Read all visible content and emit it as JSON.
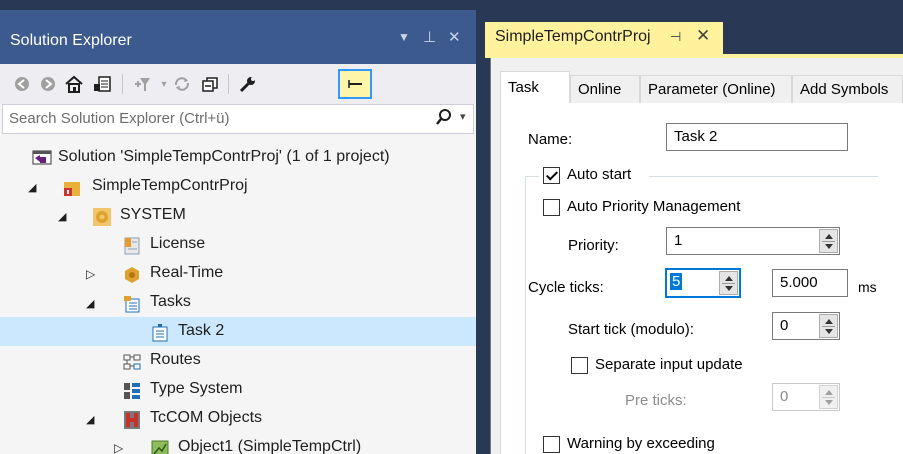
{
  "solution_explorer": {
    "title": "Solution Explorer",
    "search_placeholder": "Search Solution Explorer (Ctrl+ü)",
    "toolbar_icons": [
      "back-icon",
      "forward-icon",
      "home-icon",
      "switch-views-icon",
      "pending-changes-filter-icon",
      "sync-icon",
      "collapse-all-icon",
      "properties-wrench-icon",
      "preview-selected-icon"
    ],
    "tree": [
      {
        "label": "Solution 'SimpleTempContrProj' (1 of 1 project)",
        "icon": "solution-icon",
        "depth": 0,
        "arrow": ""
      },
      {
        "label": "SimpleTempContrProj",
        "icon": "twincat-project-icon",
        "depth": 1,
        "arrow": "expanded"
      },
      {
        "label": "SYSTEM",
        "icon": "system-gear-icon",
        "depth": 2,
        "arrow": "expanded"
      },
      {
        "label": "License",
        "icon": "license-icon",
        "depth": 3,
        "arrow": ""
      },
      {
        "label": "Real-Time",
        "icon": "realtime-icon",
        "depth": 3,
        "arrow": "collapsed"
      },
      {
        "label": "Tasks",
        "icon": "tasks-icon",
        "depth": 3,
        "arrow": "expanded"
      },
      {
        "label": "Task 2",
        "icon": "task-icon",
        "depth": 4,
        "arrow": "",
        "selected": true
      },
      {
        "label": "Routes",
        "icon": "routes-icon",
        "depth": 3,
        "arrow": ""
      },
      {
        "label": "Type System",
        "icon": "type-system-icon",
        "depth": 3,
        "arrow": ""
      },
      {
        "label": "TcCOM Objects",
        "icon": "tccom-objects-icon",
        "depth": 3,
        "arrow": "expanded"
      },
      {
        "label": "Object1 (SimpleTempCtrl)",
        "icon": "object-icon",
        "depth": 4,
        "arrow": "collapsed"
      }
    ]
  },
  "document": {
    "tab_title": "SimpleTempContrProj",
    "tabs": [
      "Task",
      "Online",
      "Parameter (Online)",
      "Add Symbols"
    ],
    "active_tab": "Task",
    "form": {
      "name_label": "Name:",
      "name_value": "Task 2",
      "auto_start_label": "Auto start",
      "auto_start_checked": true,
      "auto_priority_label": "Auto Priority Management",
      "auto_priority_checked": false,
      "priority_label": "Priority:",
      "priority_value": "1",
      "cycle_ticks_label": "Cycle ticks:",
      "cycle_ticks_value": "5",
      "cycle_time_value": "5.000",
      "cycle_unit": "ms",
      "start_tick_label": "Start tick (modulo):",
      "start_tick_value": "0",
      "separate_input_label": "Separate input update",
      "separate_input_checked": false,
      "pre_ticks_label": "Pre ticks:",
      "pre_ticks_value": "0",
      "warning_label": "Warning by exceeding",
      "warning_checked": false
    }
  },
  "colors": {
    "title_bar": "#3d5a8e",
    "active_doc_tab": "#fff29d",
    "selection": "#cce8ff",
    "focus": "#0078d7"
  }
}
